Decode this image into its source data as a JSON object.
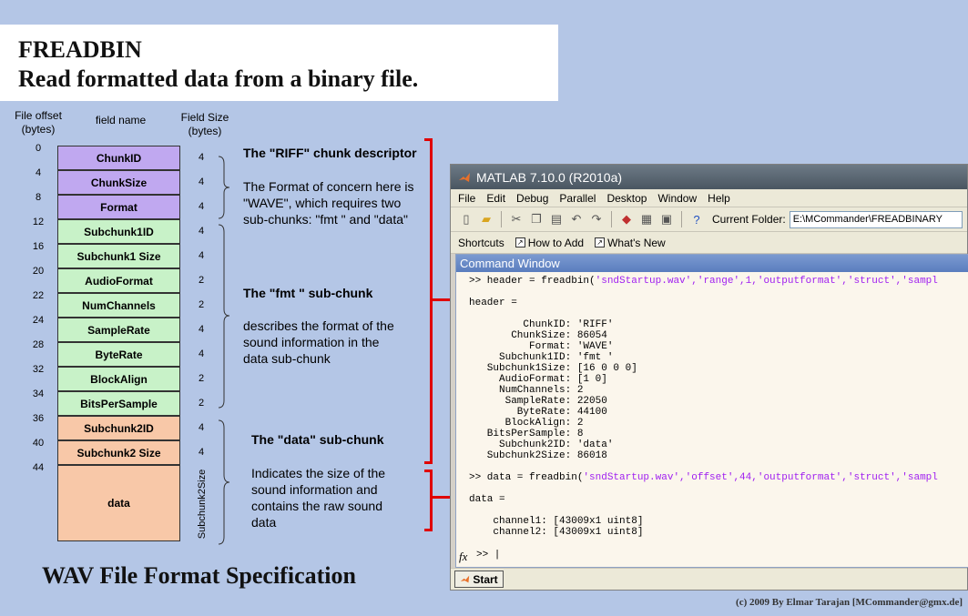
{
  "title": {
    "line1": "FREADBIN",
    "line2": "Read formatted data from a binary file."
  },
  "headers": {
    "offset": "File offset\n(bytes)",
    "field": "field name",
    "size": "Field Size\n(bytes)"
  },
  "fields": [
    {
      "offset": "0",
      "name": "ChunkID",
      "size": "4",
      "color": "#c0a8f0"
    },
    {
      "offset": "4",
      "name": "ChunkSize",
      "size": "4",
      "color": "#c0a8f0"
    },
    {
      "offset": "8",
      "name": "Format",
      "size": "4",
      "color": "#c0a8f0"
    },
    {
      "offset": "12",
      "name": "Subchunk1ID",
      "size": "4",
      "color": "#c8f2c8"
    },
    {
      "offset": "16",
      "name": "Subchunk1 Size",
      "size": "4",
      "color": "#c8f2c8"
    },
    {
      "offset": "20",
      "name": "AudioFormat",
      "size": "2",
      "color": "#c8f2c8"
    },
    {
      "offset": "22",
      "name": "NumChannels",
      "size": "2",
      "color": "#c8f2c8"
    },
    {
      "offset": "24",
      "name": "SampleRate",
      "size": "4",
      "color": "#c8f2c8"
    },
    {
      "offset": "28",
      "name": "ByteRate",
      "size": "4",
      "color": "#c8f2c8"
    },
    {
      "offset": "32",
      "name": "BlockAlign",
      "size": "2",
      "color": "#c8f2c8"
    },
    {
      "offset": "34",
      "name": "BitsPerSample",
      "size": "2",
      "color": "#c8f2c8"
    },
    {
      "offset": "36",
      "name": "Subchunk2ID",
      "size": "4",
      "color": "#f8c8a8"
    },
    {
      "offset": "40",
      "name": "Subchunk2 Size",
      "size": "4",
      "color": "#f8c8a8"
    },
    {
      "offset": "44",
      "name": "data",
      "size": "Subchunk2Size",
      "color": "#f8c8a8"
    }
  ],
  "descriptions": {
    "riff_title": "The \"RIFF\" chunk descriptor",
    "riff_text": "The Format of concern here is \"WAVE\", which requires two sub-chunks: \"fmt \" and \"data\"",
    "fmt_title": "The \"fmt \" sub-chunk",
    "fmt_text": "describes the format of the sound information in the data sub-chunk",
    "data_title": "The \"data\" sub-chunk",
    "data_text": "Indicates the size of the sound information and contains the raw sound data"
  },
  "footer": {
    "title": "WAV File Format Specification",
    "copyright": "(c) 2009 By Elmar Tarajan [MCommander@gmx.de]"
  },
  "matlab": {
    "window_title": "MATLAB  7.10.0 (R2010a)",
    "menu": [
      "File",
      "Edit",
      "Debug",
      "Parallel",
      "Desktop",
      "Window",
      "Help"
    ],
    "current_folder_label": "Current Folder:",
    "current_folder_value": "E:\\MCommander\\FREADBINARY",
    "shortcuts": {
      "shortcuts": "Shortcuts",
      "how_to_add": "How to Add",
      "whats_new": "What's New"
    },
    "command_window_title": "Command Window",
    "cmd1_prefix": ">> header = freadbin(",
    "cmd1_args": "'sndStartup.wav','range',1,'outputformat','struct','sampl",
    "header_label": "header =",
    "header_struct": "         ChunkID: 'RIFF'\n       ChunkSize: 86054\n          Format: 'WAVE'\n     Subchunk1ID: 'fmt '\n   Subchunk1Size: [16 0 0 0]\n     AudioFormat: [1 0]\n     NumChannels: 2\n      SampleRate: 22050\n        ByteRate: 44100\n      BlockAlign: 2\n   BitsPerSample: 8\n     Subchunk2ID: 'data'\n   Subchunk2Size: 86018",
    "cmd2_prefix": ">> data = freadbin(",
    "cmd2_args": "'sndStartup.wav','offset',44,'outputformat','struct','sampl",
    "data_label": "data =",
    "data_struct": "    channel1: [43009x1 uint8]\n    channel2: [43009x1 uint8]",
    "fx": "fx",
    "prompt": ">> |",
    "start": "Start"
  }
}
